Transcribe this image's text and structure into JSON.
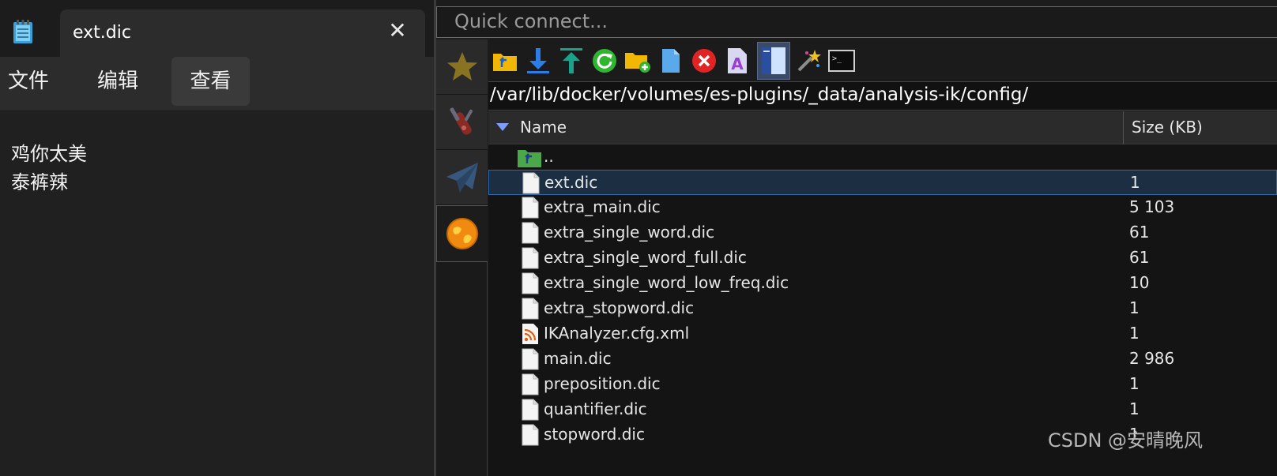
{
  "notepad": {
    "tab_title": "ext.dic",
    "close_glyph": "✕",
    "menu": [
      "文件",
      "编辑",
      "查看"
    ],
    "content_lines": [
      "鸡你太美",
      "泰裤辣"
    ]
  },
  "sftp": {
    "quick_connect_placeholder": "Quick connect...",
    "path": "/var/lib/docker/volumes/es-plugins/_data/analysis-ik/config/",
    "columns": {
      "name": "Name",
      "size": "Size (KB)"
    },
    "parent_label": "..",
    "files": [
      {
        "name": "ext.dic",
        "size": "1",
        "icon": "file-icon",
        "selected": true
      },
      {
        "name": "extra_main.dic",
        "size": "5 103",
        "icon": "file-icon"
      },
      {
        "name": "extra_single_word.dic",
        "size": "61",
        "icon": "file-icon"
      },
      {
        "name": "extra_single_word_full.dic",
        "size": "61",
        "icon": "file-icon"
      },
      {
        "name": "extra_single_word_low_freq.dic",
        "size": "10",
        "icon": "file-icon"
      },
      {
        "name": "extra_stopword.dic",
        "size": "1",
        "icon": "file-icon"
      },
      {
        "name": "IKAnalyzer.cfg.xml",
        "size": "1",
        "icon": "rss-xml-icon"
      },
      {
        "name": "main.dic",
        "size": "2 986",
        "icon": "file-icon"
      },
      {
        "name": "preposition.dic",
        "size": "1",
        "icon": "file-icon"
      },
      {
        "name": "quantifier.dic",
        "size": "1",
        "icon": "file-icon"
      },
      {
        "name": "stopword.dic",
        "size": "1",
        "icon": "file-icon"
      }
    ],
    "sidebar_icons": [
      "star-icon",
      "tools-icon",
      "paper-plane-icon",
      "globe-icon"
    ],
    "toolbar_icons": [
      "parent-folder-icon",
      "download-icon",
      "upload-icon",
      "refresh-icon",
      "new-folder-icon",
      "new-file-icon",
      "delete-icon",
      "rename-icon",
      "split-view-icon",
      "magic-wand-icon",
      "terminal-icon"
    ],
    "terminal_prompt": ">_"
  },
  "watermark": "CSDN @安晴晚风",
  "colors": {
    "selection_bg": "#1c2e42",
    "selection_border": "#2f6aa8",
    "sort_arrow": "#7f9cff"
  }
}
